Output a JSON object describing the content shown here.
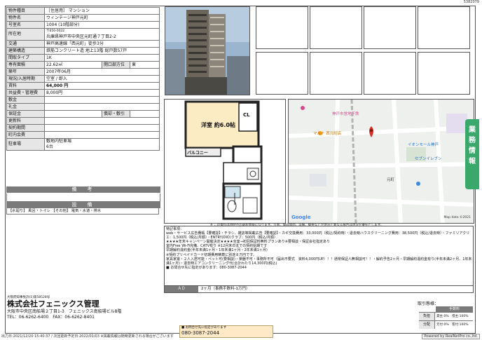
{
  "doc_code": "5382079",
  "table": [
    {
      "label": "物件種目",
      "value": "［住居用］ マンション"
    },
    {
      "label": "物件名",
      "value": "ウィンテージ神戸元町"
    },
    {
      "label": "号室名",
      "value": "1004 (10階部分)"
    },
    {
      "label": "所在地",
      "value": "〒650-0022",
      "value2": "兵庫県神戸市中央区元町通７丁目2-2"
    },
    {
      "label": "交通",
      "value": "神戸高速線「西元町」徒歩3分"
    },
    {
      "label": "建築構造",
      "value": "鉄筋コンクリート造 地上13階 総戸数57戸"
    },
    {
      "label": "間取タイプ",
      "value": "1K"
    },
    {
      "label": "専有面積",
      "value": "22.62㎡",
      "sub_label": "開口部方位",
      "sub_value": "東"
    },
    {
      "label": "築年",
      "value": "2007年06月"
    },
    {
      "label": "現況/入居時期",
      "value": "空室 / 即入"
    },
    {
      "label": "賃料",
      "value": "64,000 円",
      "big": true
    },
    {
      "label": "共益費・管理費",
      "value": "8,000円"
    },
    {
      "label": "敷金",
      "value": ""
    },
    {
      "label": "礼金",
      "value": ""
    },
    {
      "label": "保証金",
      "value": "",
      "sub_label": "償却・敷引",
      "sub_value": ""
    },
    {
      "label": "更新料",
      "value": ""
    },
    {
      "label": "契約期間",
      "value": ""
    },
    {
      "label": "町内会費",
      "value": ""
    },
    {
      "label": "駐車場",
      "value": "敷地内駐車場",
      "value2": "6台"
    }
  ],
  "bikou_title": "備　考",
  "setsubi_title": "設　備",
  "setsubi_text": "【水廻り】 風呂・トイレ 【その他】 電気・水道・排水",
  "floor": {
    "room_label": "洋室 約6.0帖",
    "cl_label": "CL",
    "balcony_label": "バルコニー"
  },
  "map": {
    "labels": [
      "神戸市営地下鉄",
      "マルナ 西元町店",
      "元町",
      "イオンモール神戸",
      "セブンイレブン",
      "Google",
      "Map data ©2021"
    ]
  },
  "side_tab": "業務情報",
  "remarks_note": "※ この資料は現時点の最新情報になります。写真、間取図面、設備、概要などが現況と異なる場合は現況を優先とします。",
  "remarks_lines": [
    "特記事項：",
    "web・サービス広告費帳【要確認】・チラシ、雑誌等掲載広告【要確認】・カギ交換費用：33,000円（税込/契約時）・退去時ハウスクリーニング費用：38,500円（税込/退去時）・ファミリアクリエ：1,500円（税込/月額）・ENTRY(DIO)クラブ：500円（税込/月額）",
    "★★★★年末キャンペーン開催決定★★★★全室→初回保証料無料プランあり※要相談・保証会社指定あり",
    "室内Free Wi-Fi完備、CATV有り ※12月末日までの契約始期です",
    "早期解約違約金(半年未満1ヶ月・1年未満1ヶ月・2年未満1ヶ月)",
    "※契約プリペイドカード初期費用精算に別途８万円です。",
    "家具家電・２人入居可能・ペット可(要相談)・楽器不可・事務所不可（届出不要式　資料4,000円UP）！！通常保証人無相談可！！・解約予告2ヶ月・早期解約違約金有り(半年未満2ヶ月、1年未満1ヶ月)・退去時エアコンクリーニング代(合計わたり14,300円(税込)",
    "■ お問合せ先に指定があります：080-3087-2044"
  ],
  "ad_label": "ＡＤ",
  "ad_value": "2ヶ月（事務手数料-1万円）",
  "company": {
    "license": "大阪府知事免許(1)第58528号",
    "name": "株式会社フェニックス管理",
    "address": "大阪市中央区南船場２丁目1-3　フェニックス南船場ビル8階",
    "contact": "TEL：06-6262-6400　FAX：06-6262-8401"
  },
  "inquiry": {
    "label": "■ お問合せ先に指定があります",
    "phone": "080-3087-2044"
  },
  "trade": {
    "title": "取引態様：",
    "header": "手数料",
    "rows": [
      [
        "負担",
        "貸主:0%　借主:100%"
      ],
      [
        "分配",
        "元付:0%　客付:100%"
      ]
    ]
  },
  "footer_left": "出力日:2021/12/20 15:40:37 / 次回更新予定日:2022/01/03 ※掲載情報は随時更新される場合がございます",
  "footer_right": "Powered by RealNetPro co.,ltd."
}
